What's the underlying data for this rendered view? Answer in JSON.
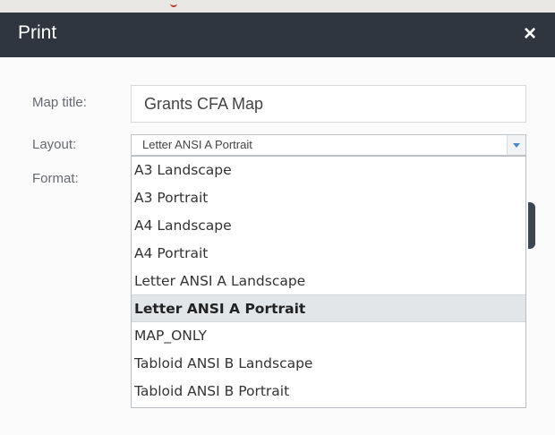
{
  "dialog": {
    "title": "Print",
    "close_symbol": "×"
  },
  "form": {
    "map_title_label": "Map title:",
    "map_title_value": "Grants CFA Map",
    "layout_label": "Layout:",
    "layout_value": "Letter ANSI A Portrait",
    "format_label": "Format:"
  },
  "layout_options": [
    "A3 Landscape",
    "A3 Portrait",
    "A4 Landscape",
    "A4 Portrait",
    "Letter ANSI A Landscape",
    "Letter ANSI A Portrait",
    "MAP_ONLY",
    "Tabloid ANSI B Landscape",
    "Tabloid ANSI B Portrait"
  ],
  "colors": {
    "title_bar": "#2f3640",
    "selected_option_bg": "#e3e6e9",
    "select_arrow": "#4a89c3"
  }
}
